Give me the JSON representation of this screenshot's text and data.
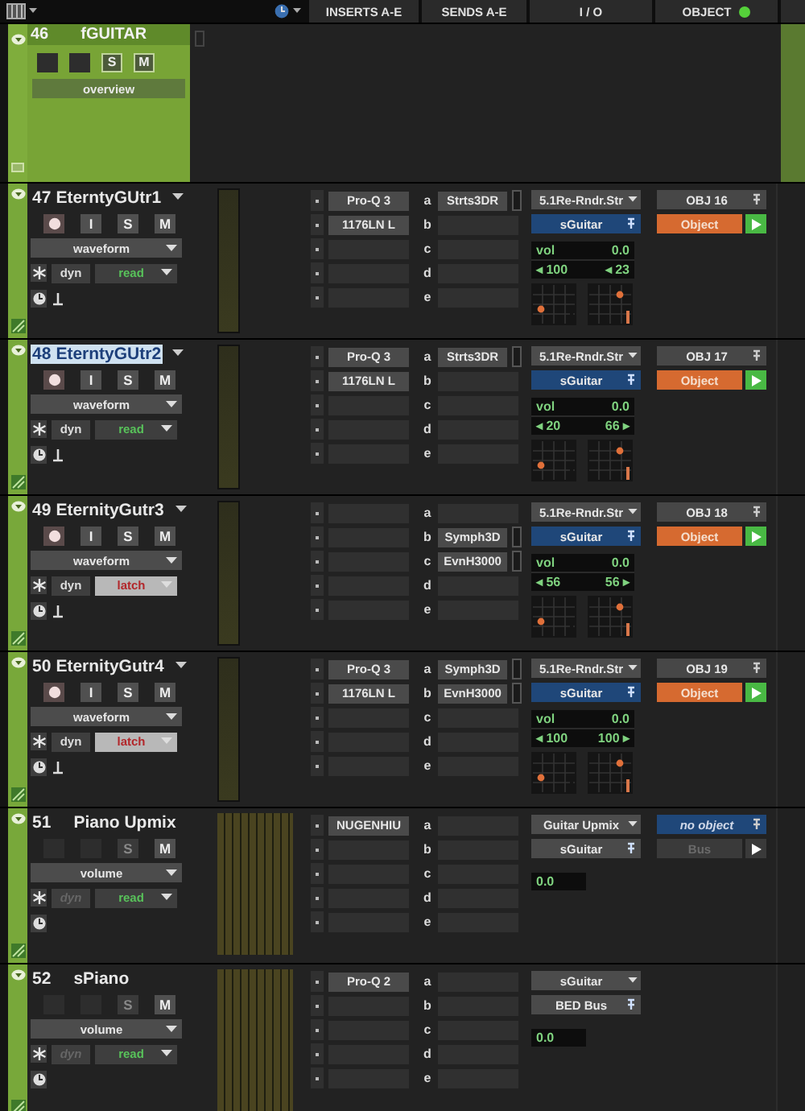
{
  "header": {
    "columns": [
      {
        "label": "INSERTS A-E"
      },
      {
        "label": "SENDS A-E"
      },
      {
        "label": "I / O"
      },
      {
        "label": "OBJECT",
        "indicator_on": true
      }
    ]
  },
  "folder": {
    "number": "46",
    "name": "fGUITAR",
    "buttons": [
      "S",
      "M"
    ],
    "view": "overview"
  },
  "tracks": [
    {
      "kind": "audio",
      "number": "47",
      "name": "EterntyGUtr1",
      "selected": false,
      "buttons": [
        "I",
        "S",
        "M"
      ],
      "view": "waveform",
      "dyn": "dyn",
      "dyn_enabled": true,
      "automation": {
        "label": "read",
        "kind": "read"
      },
      "inserts": [
        "Pro-Q 3",
        "1176LN L"
      ],
      "sends": [
        {
          "slot": "a",
          "name": "Strts3DR"
        },
        {
          "slot": "b"
        },
        {
          "slot": "c"
        },
        {
          "slot": "d"
        },
        {
          "slot": "e"
        }
      ],
      "io": {
        "output": "5.1Re-Rndr.Str",
        "bus": "sGuitar",
        "bus_object": true,
        "volume_label": "vol",
        "volume": "0.0",
        "pan": [
          {
            "value": "◂ 100"
          },
          {
            "value": "◂ 23"
          }
        ]
      },
      "object": {
        "kind": "object",
        "name": "OBJ 16",
        "mode": "Object",
        "mode_enabled": true
      }
    },
    {
      "kind": "audio",
      "number": "48",
      "name": "EterntyGUtr2",
      "selected": true,
      "buttons": [
        "I",
        "S",
        "M"
      ],
      "view": "waveform",
      "dyn": "dyn",
      "dyn_enabled": true,
      "automation": {
        "label": "read",
        "kind": "read"
      },
      "inserts": [
        "Pro-Q 3",
        "1176LN L"
      ],
      "sends": [
        {
          "slot": "a",
          "name": "Strts3DR"
        },
        {
          "slot": "b"
        },
        {
          "slot": "c"
        },
        {
          "slot": "d"
        },
        {
          "slot": "e"
        }
      ],
      "io": {
        "output": "5.1Re-Rndr.Str",
        "bus": "sGuitar",
        "bus_object": true,
        "volume_label": "vol",
        "volume": "0.0",
        "pan": [
          {
            "value": "◂ 20"
          },
          {
            "value": "66 ▸"
          }
        ]
      },
      "object": {
        "kind": "object",
        "name": "OBJ 17",
        "mode": "Object",
        "mode_enabled": true
      }
    },
    {
      "kind": "audio",
      "number": "49",
      "name": "EternityGutr3",
      "selected": false,
      "buttons": [
        "I",
        "S",
        "M"
      ],
      "view": "waveform",
      "dyn": "dyn",
      "dyn_enabled": true,
      "automation": {
        "label": "latch",
        "kind": "latch"
      },
      "sends": [
        {
          "slot": "a"
        },
        {
          "slot": "b",
          "name": "Symph3D"
        },
        {
          "slot": "c",
          "name": "EvnH3000"
        },
        {
          "slot": "d"
        },
        {
          "slot": "e"
        }
      ],
      "io": {
        "output": "5.1Re-Rndr.Str",
        "bus": "sGuitar",
        "bus_object": true,
        "volume_label": "vol",
        "volume": "0.0",
        "pan": [
          {
            "value": "◂ 56"
          },
          {
            "value": "56 ▸"
          }
        ]
      },
      "object": {
        "kind": "object",
        "name": "OBJ 18",
        "mode": "Object",
        "mode_enabled": true
      }
    },
    {
      "kind": "audio",
      "number": "50",
      "name": "EternityGutr4",
      "selected": false,
      "buttons": [
        "I",
        "S",
        "M"
      ],
      "view": "waveform",
      "dyn": "dyn",
      "dyn_enabled": true,
      "automation": {
        "label": "latch",
        "kind": "latch"
      },
      "inserts": [
        "Pro-Q 3",
        "1176LN L"
      ],
      "sends": [
        {
          "slot": "a",
          "name": "Symph3D"
        },
        {
          "slot": "b",
          "name": "EvnH3000"
        },
        {
          "slot": "c"
        },
        {
          "slot": "d"
        },
        {
          "slot": "e"
        }
      ],
      "io": {
        "output": "5.1Re-Rndr.Str",
        "bus": "sGuitar",
        "bus_object": true,
        "volume_label": "vol",
        "volume": "0.0",
        "pan": [
          {
            "value": "◂ 100"
          },
          {
            "value": "100 ▸"
          }
        ]
      },
      "object": {
        "kind": "object",
        "name": "OBJ 19",
        "mode": "Object",
        "mode_enabled": true
      }
    },
    {
      "kind": "aux",
      "number": "51",
      "name": "Piano Upmix",
      "selected": false,
      "buttons": [
        "S",
        "M"
      ],
      "view": "volume",
      "dyn": "dyn",
      "dyn_enabled": false,
      "automation": {
        "label": "read",
        "kind": "read"
      },
      "inserts": [
        "NUGENHIU"
      ],
      "sends": [
        {
          "slot": "a"
        },
        {
          "slot": "b"
        },
        {
          "slot": "c"
        },
        {
          "slot": "d"
        },
        {
          "slot": "e"
        }
      ],
      "io": {
        "output": "Guitar Upmix",
        "bus": "sGuitar",
        "bus_object": false,
        "volume": "0.0"
      },
      "object": {
        "kind": "none",
        "name": "no object",
        "mode": "Bus",
        "mode_enabled": false
      }
    },
    {
      "kind": "aux",
      "number": "52",
      "name": "sPiano",
      "selected": false,
      "buttons": [
        "S",
        "M"
      ],
      "view": "volume",
      "dyn": "dyn",
      "dyn_enabled": false,
      "automation": {
        "label": "read",
        "kind": "read"
      },
      "inserts": [
        "Pro-Q 2"
      ],
      "sends": [
        {
          "slot": "a"
        },
        {
          "slot": "b"
        },
        {
          "slot": "c"
        },
        {
          "slot": "d"
        },
        {
          "slot": "e"
        }
      ],
      "io": {
        "output": "sGuitar",
        "bus": "BED Bus",
        "bus_object": false,
        "volume": "0.0"
      }
    }
  ]
}
